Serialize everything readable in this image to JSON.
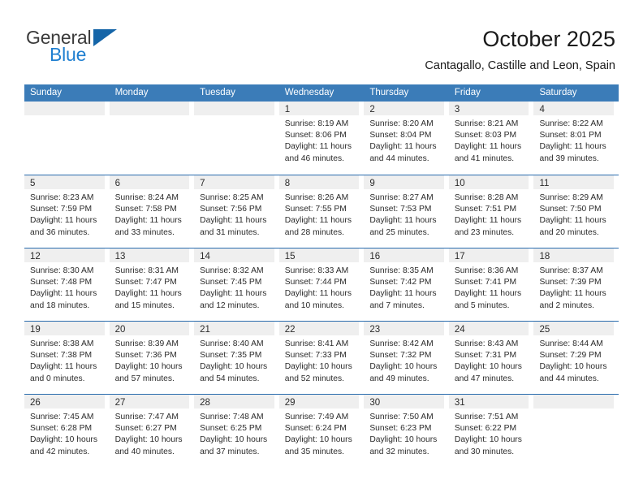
{
  "brand": {
    "name_part1": "General",
    "name_part2": "Blue",
    "accent_color": "#1f7fd0",
    "triangle_color": "#1565a8"
  },
  "header": {
    "title": "October 2025",
    "location": "Cantagallo, Castille and Leon, Spain"
  },
  "theme": {
    "header_band_color": "#3b7cb8",
    "week_divider_color": "#2a6cad",
    "daynum_strip_color": "#efefef"
  },
  "weekday_headers": [
    "Sunday",
    "Monday",
    "Tuesday",
    "Wednesday",
    "Thursday",
    "Friday",
    "Saturday"
  ],
  "weeks": [
    [
      {
        "day": "",
        "lines": []
      },
      {
        "day": "",
        "lines": []
      },
      {
        "day": "",
        "lines": []
      },
      {
        "day": "1",
        "lines": [
          "Sunrise: 8:19 AM",
          "Sunset: 8:06 PM",
          "Daylight: 11 hours",
          "and 46 minutes."
        ]
      },
      {
        "day": "2",
        "lines": [
          "Sunrise: 8:20 AM",
          "Sunset: 8:04 PM",
          "Daylight: 11 hours",
          "and 44 minutes."
        ]
      },
      {
        "day": "3",
        "lines": [
          "Sunrise: 8:21 AM",
          "Sunset: 8:03 PM",
          "Daylight: 11 hours",
          "and 41 minutes."
        ]
      },
      {
        "day": "4",
        "lines": [
          "Sunrise: 8:22 AM",
          "Sunset: 8:01 PM",
          "Daylight: 11 hours",
          "and 39 minutes."
        ]
      }
    ],
    [
      {
        "day": "5",
        "lines": [
          "Sunrise: 8:23 AM",
          "Sunset: 7:59 PM",
          "Daylight: 11 hours",
          "and 36 minutes."
        ]
      },
      {
        "day": "6",
        "lines": [
          "Sunrise: 8:24 AM",
          "Sunset: 7:58 PM",
          "Daylight: 11 hours",
          "and 33 minutes."
        ]
      },
      {
        "day": "7",
        "lines": [
          "Sunrise: 8:25 AM",
          "Sunset: 7:56 PM",
          "Daylight: 11 hours",
          "and 31 minutes."
        ]
      },
      {
        "day": "8",
        "lines": [
          "Sunrise: 8:26 AM",
          "Sunset: 7:55 PM",
          "Daylight: 11 hours",
          "and 28 minutes."
        ]
      },
      {
        "day": "9",
        "lines": [
          "Sunrise: 8:27 AM",
          "Sunset: 7:53 PM",
          "Daylight: 11 hours",
          "and 25 minutes."
        ]
      },
      {
        "day": "10",
        "lines": [
          "Sunrise: 8:28 AM",
          "Sunset: 7:51 PM",
          "Daylight: 11 hours",
          "and 23 minutes."
        ]
      },
      {
        "day": "11",
        "lines": [
          "Sunrise: 8:29 AM",
          "Sunset: 7:50 PM",
          "Daylight: 11 hours",
          "and 20 minutes."
        ]
      }
    ],
    [
      {
        "day": "12",
        "lines": [
          "Sunrise: 8:30 AM",
          "Sunset: 7:48 PM",
          "Daylight: 11 hours",
          "and 18 minutes."
        ]
      },
      {
        "day": "13",
        "lines": [
          "Sunrise: 8:31 AM",
          "Sunset: 7:47 PM",
          "Daylight: 11 hours",
          "and 15 minutes."
        ]
      },
      {
        "day": "14",
        "lines": [
          "Sunrise: 8:32 AM",
          "Sunset: 7:45 PM",
          "Daylight: 11 hours",
          "and 12 minutes."
        ]
      },
      {
        "day": "15",
        "lines": [
          "Sunrise: 8:33 AM",
          "Sunset: 7:44 PM",
          "Daylight: 11 hours",
          "and 10 minutes."
        ]
      },
      {
        "day": "16",
        "lines": [
          "Sunrise: 8:35 AM",
          "Sunset: 7:42 PM",
          "Daylight: 11 hours",
          "and 7 minutes."
        ]
      },
      {
        "day": "17",
        "lines": [
          "Sunrise: 8:36 AM",
          "Sunset: 7:41 PM",
          "Daylight: 11 hours",
          "and 5 minutes."
        ]
      },
      {
        "day": "18",
        "lines": [
          "Sunrise: 8:37 AM",
          "Sunset: 7:39 PM",
          "Daylight: 11 hours",
          "and 2 minutes."
        ]
      }
    ],
    [
      {
        "day": "19",
        "lines": [
          "Sunrise: 8:38 AM",
          "Sunset: 7:38 PM",
          "Daylight: 11 hours",
          "and 0 minutes."
        ]
      },
      {
        "day": "20",
        "lines": [
          "Sunrise: 8:39 AM",
          "Sunset: 7:36 PM",
          "Daylight: 10 hours",
          "and 57 minutes."
        ]
      },
      {
        "day": "21",
        "lines": [
          "Sunrise: 8:40 AM",
          "Sunset: 7:35 PM",
          "Daylight: 10 hours",
          "and 54 minutes."
        ]
      },
      {
        "day": "22",
        "lines": [
          "Sunrise: 8:41 AM",
          "Sunset: 7:33 PM",
          "Daylight: 10 hours",
          "and 52 minutes."
        ]
      },
      {
        "day": "23",
        "lines": [
          "Sunrise: 8:42 AM",
          "Sunset: 7:32 PM",
          "Daylight: 10 hours",
          "and 49 minutes."
        ]
      },
      {
        "day": "24",
        "lines": [
          "Sunrise: 8:43 AM",
          "Sunset: 7:31 PM",
          "Daylight: 10 hours",
          "and 47 minutes."
        ]
      },
      {
        "day": "25",
        "lines": [
          "Sunrise: 8:44 AM",
          "Sunset: 7:29 PM",
          "Daylight: 10 hours",
          "and 44 minutes."
        ]
      }
    ],
    [
      {
        "day": "26",
        "lines": [
          "Sunrise: 7:45 AM",
          "Sunset: 6:28 PM",
          "Daylight: 10 hours",
          "and 42 minutes."
        ]
      },
      {
        "day": "27",
        "lines": [
          "Sunrise: 7:47 AM",
          "Sunset: 6:27 PM",
          "Daylight: 10 hours",
          "and 40 minutes."
        ]
      },
      {
        "day": "28",
        "lines": [
          "Sunrise: 7:48 AM",
          "Sunset: 6:25 PM",
          "Daylight: 10 hours",
          "and 37 minutes."
        ]
      },
      {
        "day": "29",
        "lines": [
          "Sunrise: 7:49 AM",
          "Sunset: 6:24 PM",
          "Daylight: 10 hours",
          "and 35 minutes."
        ]
      },
      {
        "day": "30",
        "lines": [
          "Sunrise: 7:50 AM",
          "Sunset: 6:23 PM",
          "Daylight: 10 hours",
          "and 32 minutes."
        ]
      },
      {
        "day": "31",
        "lines": [
          "Sunrise: 7:51 AM",
          "Sunset: 6:22 PM",
          "Daylight: 10 hours",
          "and 30 minutes."
        ]
      },
      {
        "day": "",
        "lines": []
      }
    ]
  ]
}
